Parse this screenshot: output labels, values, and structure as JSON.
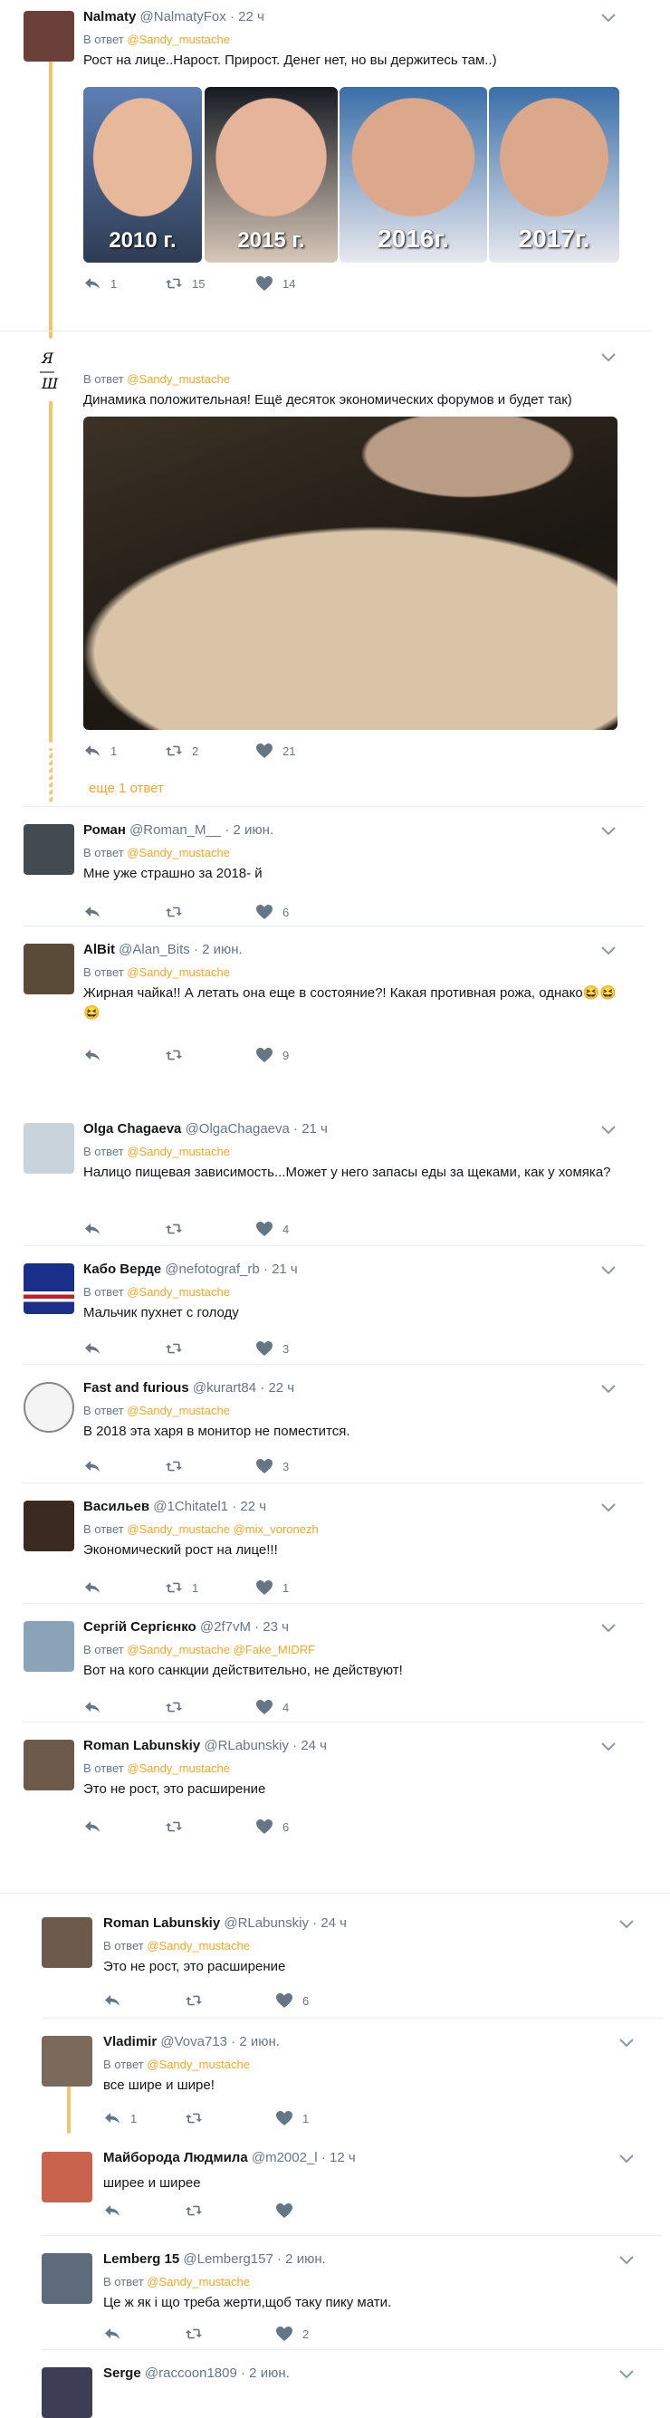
{
  "reply_prefix": "В ответ",
  "more_replies": "еще 1 ответ",
  "tweets": [
    {
      "name": "Nalmaty",
      "handle": "@NalmatyFox",
      "time": "· 22 ч",
      "reply_to": "@Sandy_mustache",
      "text": "Рост на лице..Нарост. Прирост. Денег нет, но вы держитесь там..)",
      "replies": "1",
      "retweets": "15",
      "likes": "14",
      "image_captions": [
        "2010 г.",
        "2015 г.",
        "2016г.",
        "2017г."
      ]
    },
    {
      "name": "",
      "handle": "",
      "time": "",
      "reply_to": "@Sandy_mustache",
      "text": "Динамика положительная! Ещё десяток экономических форумов и будет так)",
      "replies": "1",
      "retweets": "2",
      "likes": "21"
    },
    {
      "name": "Роман",
      "handle": "@Roman_M__",
      "time": "· 2 июн.",
      "reply_to": "@Sandy_mustache",
      "text": "Мне уже страшно за 2018- й",
      "replies": "",
      "retweets": "",
      "likes": "6"
    },
    {
      "name": "AlBit",
      "handle": "@Alan_Bits",
      "time": "· 2 июн.",
      "reply_to": "@Sandy_mustache",
      "text": "Жирная чайка!! А летать она еще в состояние?! Какая противная рожа, однако😆😆😆",
      "replies": "",
      "retweets": "",
      "likes": "9"
    },
    {
      "name": "Olga Chagaeva",
      "handle": "@OlgaChagaeva",
      "time": "· 21 ч",
      "reply_to": "@Sandy_mustache",
      "text": "Налицо пищевая зависимость...Может у него запасы еды за щеками, как у хомяка?",
      "replies": "",
      "retweets": "",
      "likes": "4"
    },
    {
      "name": "Кабо Верде",
      "handle": "@nefotograf_rb",
      "time": "· 21 ч",
      "reply_to": "@Sandy_mustache",
      "text": "Мальчик пухнет с голоду",
      "replies": "",
      "retweets": "",
      "likes": "3"
    },
    {
      "name": "Fast and furious",
      "handle": "@kurart84",
      "time": "· 22 ч",
      "reply_to": "@Sandy_mustache",
      "text": "В 2018 эта харя в монитор не поместится.",
      "replies": "",
      "retweets": "",
      "likes": "3"
    },
    {
      "name": "Васильев",
      "handle": "@1Chitatel1",
      "time": "· 22 ч",
      "reply_to": "@Sandy_mustache @mix_voronezh",
      "text": "Экономический рост на лице!!!",
      "replies": "",
      "retweets": "1",
      "likes": "1"
    },
    {
      "name": "Сергій Сергієнко",
      "handle": "@2f7vM",
      "time": "· 23 ч",
      "reply_to": "@Sandy_mustache @Fake_MIDRF",
      "text": "Вот на кого санкции действительно, не действуют!",
      "replies": "",
      "retweets": "",
      "likes": "4"
    },
    {
      "name": "Roman Labunskiy",
      "handle": "@RLabunskiy",
      "time": "· 24 ч",
      "reply_to": "@Sandy_mustache",
      "text": "Это не рост, это расширение",
      "replies": "",
      "retweets": "",
      "likes": "6"
    },
    {
      "name": "Roman Labunskiy",
      "handle": "@RLabunskiy",
      "time": "· 24 ч",
      "reply_to": "@Sandy_mustache",
      "text": "Это не рост, это расширение",
      "replies": "",
      "retweets": "",
      "likes": "6"
    },
    {
      "name": "Vladimir",
      "handle": "@Vova713",
      "time": "· 2 июн.",
      "reply_to": "@Sandy_mustache",
      "text": "все шире и шире!",
      "replies": "1",
      "retweets": "",
      "likes": "1"
    },
    {
      "name": "Майборода Людмила",
      "handle": "@m2002_l",
      "time": "· 12 ч",
      "reply_to": "",
      "text": "ширее и ширее",
      "replies": "",
      "retweets": "",
      "likes": ""
    },
    {
      "name": "Lemberg 15",
      "handle": "@Lemberg157",
      "time": "· 2 июн.",
      "reply_to": "@Sandy_mustache",
      "text": "Це ж як і що треба жерти,щоб таку пику мати.",
      "replies": "",
      "retweets": "",
      "likes": "2"
    },
    {
      "name": "Serge",
      "handle": "@raccoon1809",
      "time": "· 2 июн.",
      "reply_to": "",
      "text": "",
      "replies": "",
      "retweets": "",
      "likes": ""
    }
  ]
}
